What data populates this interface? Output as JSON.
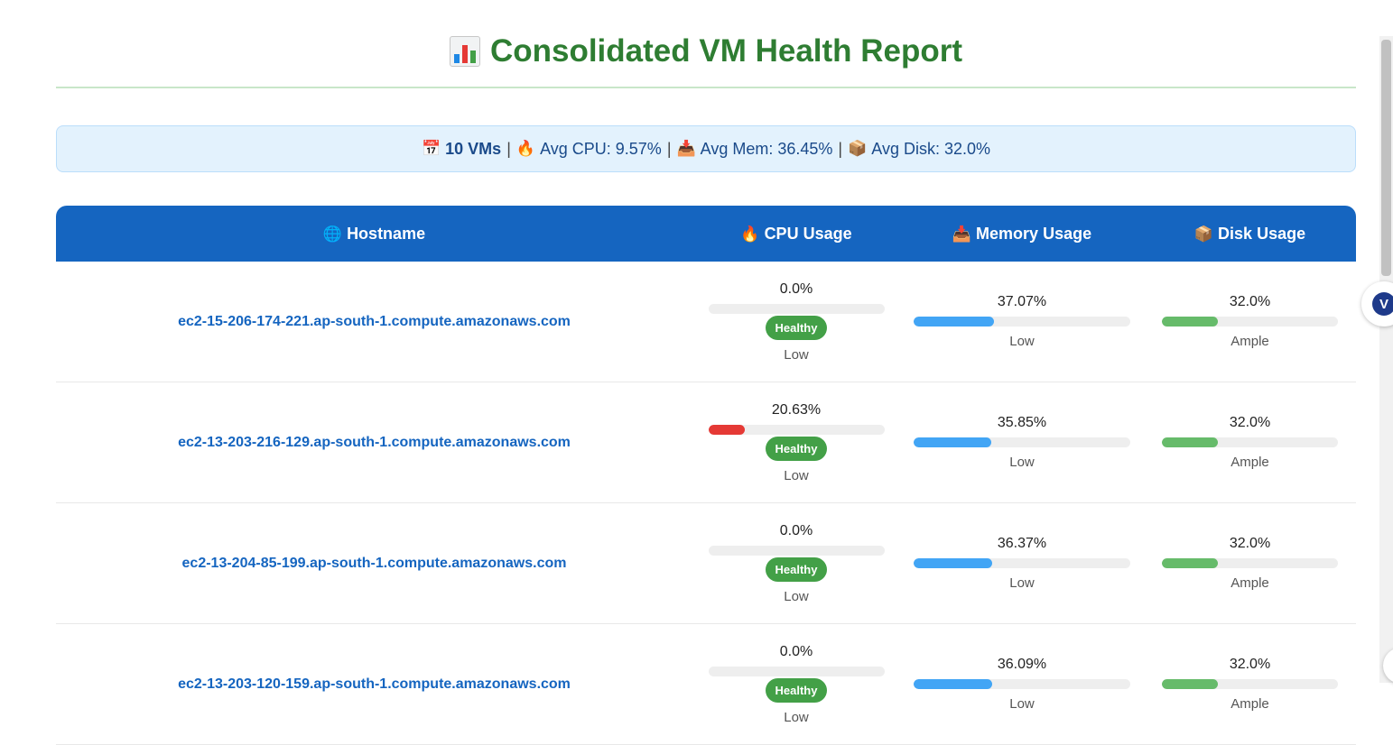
{
  "title": {
    "icon": "bar-chart-icon",
    "text": "Consolidated VM Health Report",
    "color": "#2e7d32"
  },
  "summary": {
    "vm_count": "10 VMs",
    "avg_cpu": "Avg CPU: 9.57%",
    "avg_mem": "Avg Mem: 36.45%",
    "avg_disk": "Avg Disk: 32.0%",
    "separator": "|",
    "icons": {
      "vms": "calendar-icon",
      "cpu": "fire-icon",
      "mem": "inbox-tray-icon",
      "disk": "package-icon"
    }
  },
  "table": {
    "headers": {
      "hostname": "Hostname",
      "cpu": "CPU Usage",
      "memory": "Memory Usage",
      "disk": "Disk Usage"
    },
    "header_icons": {
      "hostname": "globe-icon",
      "cpu": "fire-icon",
      "memory": "inbox-tray-icon",
      "disk": "package-icon"
    },
    "rows": [
      {
        "hostname": "ec2-15-206-174-221.ap-south-1.compute.amazonaws.com",
        "cpu": {
          "value": "0.0%",
          "pct": 0.0,
          "status": "Healthy",
          "level": "Low"
        },
        "memory": {
          "value": "37.07%",
          "pct": 37.07,
          "level": "Low"
        },
        "disk": {
          "value": "32.0%",
          "pct": 32.0,
          "level": "Ample"
        }
      },
      {
        "hostname": "ec2-13-203-216-129.ap-south-1.compute.amazonaws.com",
        "cpu": {
          "value": "20.63%",
          "pct": 20.63,
          "status": "Healthy",
          "level": "Low"
        },
        "memory": {
          "value": "35.85%",
          "pct": 35.85,
          "level": "Low"
        },
        "disk": {
          "value": "32.0%",
          "pct": 32.0,
          "level": "Ample"
        }
      },
      {
        "hostname": "ec2-13-204-85-199.ap-south-1.compute.amazonaws.com",
        "cpu": {
          "value": "0.0%",
          "pct": 0.0,
          "status": "Healthy",
          "level": "Low"
        },
        "memory": {
          "value": "36.37%",
          "pct": 36.37,
          "level": "Low"
        },
        "disk": {
          "value": "32.0%",
          "pct": 32.0,
          "level": "Ample"
        }
      },
      {
        "hostname": "ec2-13-203-120-159.ap-south-1.compute.amazonaws.com",
        "cpu": {
          "value": "0.0%",
          "pct": 0.0,
          "status": "Healthy",
          "level": "Low"
        },
        "memory": {
          "value": "36.09%",
          "pct": 36.09,
          "level": "Low"
        },
        "disk": {
          "value": "32.0%",
          "pct": 32.0,
          "level": "Ample"
        }
      }
    ]
  },
  "colors": {
    "header_bg": "#1565c0",
    "cpu_bar": "#e53935",
    "memory_bar": "#42a5f5",
    "disk_bar": "#66bb6a",
    "healthy_badge": "#43a047",
    "hostname_text": "#1565c0"
  },
  "extension": {
    "icon": "vpn-extension-icon",
    "glyph": "V"
  }
}
